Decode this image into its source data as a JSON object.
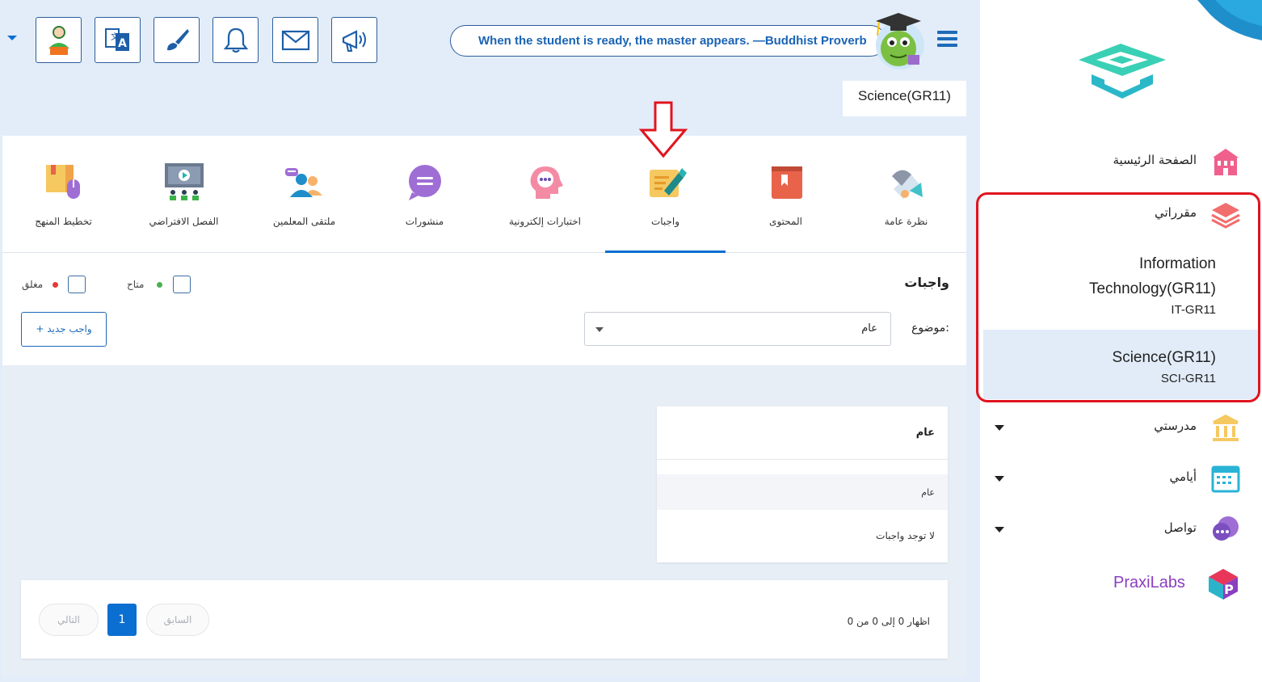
{
  "topbar": {
    "quote": "When the student is ready, the master appears. —Buddhist Proverb",
    "course_tag": "Science(GR11)",
    "tools": [
      "user-icon",
      "translate-icon",
      "brush-icon",
      "bell-icon",
      "mail-icon",
      "megaphone-icon"
    ]
  },
  "tabs": [
    {
      "label": "نظرة عامة",
      "icon": "overview-icon"
    },
    {
      "label": "المحتوى",
      "icon": "book-icon"
    },
    {
      "label": "واجبات",
      "icon": "homework-icon"
    },
    {
      "label": "اختبارات إلكترونية",
      "icon": "quiz-icon"
    },
    {
      "label": "منشورات",
      "icon": "posts-icon"
    },
    {
      "label": "ملتقى المعلمين",
      "icon": "teachers-icon"
    },
    {
      "label": "الفصل الافتراضي",
      "icon": "virtual-class-icon"
    },
    {
      "label": "تخطيط المنهج",
      "icon": "curriculum-icon"
    }
  ],
  "homework": {
    "title": "واجبات",
    "legend_available": "متاح",
    "legend_closed": "مغلق",
    "subject_label": "موضوع:",
    "subject_value": "عام",
    "new_button": "+ واجب جديد",
    "card_title": "عام",
    "card_row": "عام",
    "empty_text": "لا توجد واجبات"
  },
  "pager": {
    "info": "اظهار 0 إلى 0 من 0",
    "prev": "السابق",
    "next": "التالي",
    "page": "1"
  },
  "sidebar": {
    "home": "الصفحة الرئيسية",
    "my_courses": "مقرراتي",
    "courses": [
      {
        "name_line1": "Information",
        "name_line2": "Technology(GR11)",
        "code": "IT-GR11"
      },
      {
        "name_line1": "Science(GR11)",
        "code": "SCI-GR11"
      }
    ],
    "my_school": "مدرستي",
    "my_days": "أيامي",
    "communicate": "تواصل",
    "partner": "PraxiLabs"
  },
  "colors": {
    "accent": "#0b6fd1",
    "highlight": "#e1141e",
    "available_dot": "#4caf50",
    "closed_dot": "#e53935"
  }
}
